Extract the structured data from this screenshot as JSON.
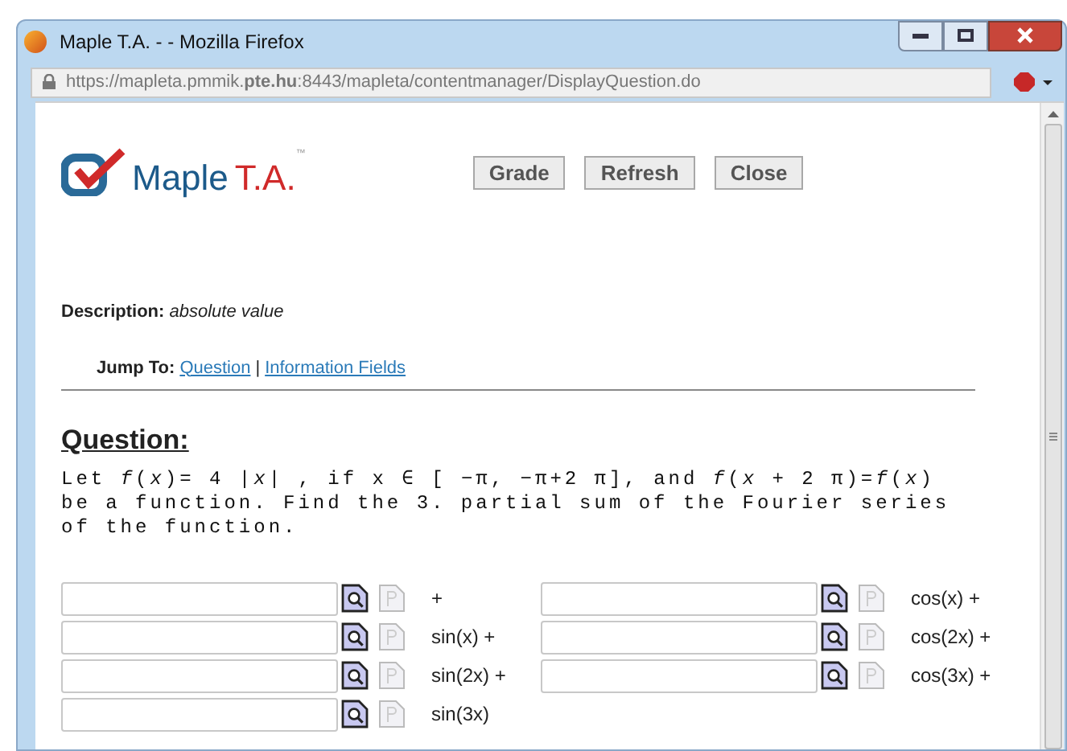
{
  "window": {
    "title": "Maple T.A. - - Mozilla Firefox"
  },
  "address_bar": {
    "url": "https://mapleta.pmmik.**pte.hu**:8443/mapleta/contentmanager/DisplayQuestion.do"
  },
  "logo": {
    "name": "Maple",
    "suffix": "T.A.",
    "mark": "™"
  },
  "buttons": [
    "Grade",
    "Refresh",
    "Close"
  ],
  "description": {
    "label": "Description:",
    "value": "absolute value"
  },
  "jump_to": {
    "label": "Jump To:",
    "links": [
      "Question",
      "Information Fields"
    ],
    "separator": "|"
  },
  "question": {
    "heading": "Question:",
    "text": "Let *f*(*x*)= 4 |*x*| , if x ∈ [ −π,  −π+2 π], and  *f*(*x* +  2 π)=*f*(*x*) be a function. Find the 3. partial sum of the Fourier series of the function."
  },
  "answer_rows": [
    {
      "fields": [
        {
          "label": "+"
        },
        {
          "label": "cos(x) +"
        }
      ]
    },
    {
      "fields": [
        {
          "label": "sin(x) +"
        },
        {
          "label": "cos(2x) +"
        }
      ]
    },
    {
      "fields": [
        {
          "label": "sin(2x) +"
        },
        {
          "label": "cos(3x) +"
        }
      ]
    },
    {
      "fields": [
        {
          "label": "sin(3x)"
        }
      ]
    }
  ]
}
